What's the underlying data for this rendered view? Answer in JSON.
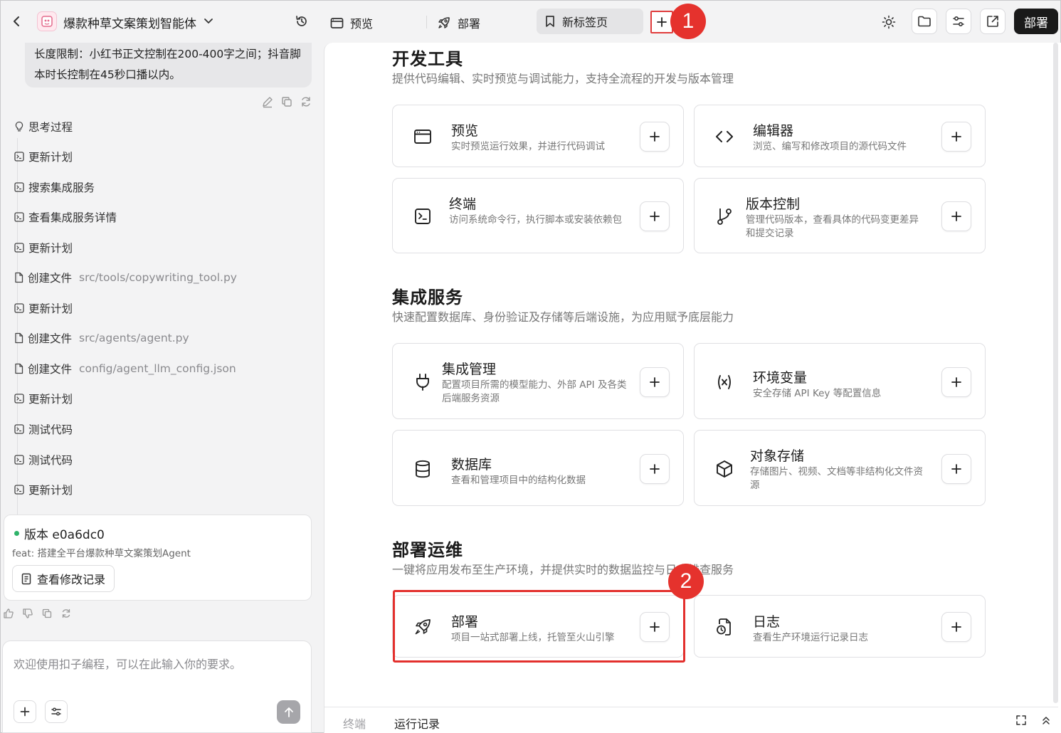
{
  "header": {
    "app_title": "爆款种草文案策划智能体",
    "tabs": [
      {
        "label": "预览",
        "icon": "browser-window-icon"
      },
      {
        "label": "部署",
        "icon": "rocket-icon"
      },
      {
        "label": "新标签页",
        "icon": "bookmark-icon",
        "active": true
      }
    ],
    "deploy_button": "部署"
  },
  "annotations": {
    "callout_1": "1",
    "callout_2": "2",
    "highlight_color": "#e3302d"
  },
  "chat": {
    "message": "长度限制：小红书正文控制在200-400字之间；抖音脚本时长控制在45秒口播以内。",
    "steps": [
      {
        "icon": "lightbulb-icon",
        "label": "思考过程",
        "path": ""
      },
      {
        "icon": "terminal-icon",
        "label": "更新计划",
        "path": ""
      },
      {
        "icon": "terminal-icon",
        "label": "搜索集成服务",
        "path": ""
      },
      {
        "icon": "terminal-icon",
        "label": "查看集成服务详情",
        "path": ""
      },
      {
        "icon": "terminal-icon",
        "label": "更新计划",
        "path": ""
      },
      {
        "icon": "file-icon",
        "label": "创建文件",
        "path": "src/tools/copywriting_tool.py"
      },
      {
        "icon": "terminal-icon",
        "label": "更新计划",
        "path": ""
      },
      {
        "icon": "file-icon",
        "label": "创建文件",
        "path": "src/agents/agent.py"
      },
      {
        "icon": "file-icon",
        "label": "创建文件",
        "path": "config/agent_llm_config.json"
      },
      {
        "icon": "terminal-icon",
        "label": "更新计划",
        "path": ""
      },
      {
        "icon": "terminal-icon",
        "label": "测试代码",
        "path": ""
      },
      {
        "icon": "terminal-icon",
        "label": "测试代码",
        "path": ""
      },
      {
        "icon": "terminal-icon",
        "label": "更新计划",
        "path": ""
      }
    ],
    "version": {
      "title": "版本 e0a6dc0",
      "commit": "feat: 搭建全平台爆款种草文案策划Agent",
      "button": "查看修改记录",
      "status_color": "#2fb36a"
    },
    "composer": {
      "placeholder": "欢迎使用扣子编程，可以在此输入你的要求。"
    }
  },
  "sections": [
    {
      "title": "开发工具",
      "desc": "提供代码编辑、实时预览与调试能力，支持全流程的开发与版本管理",
      "cards": [
        {
          "title": "预览",
          "desc": "实时预览运行效果，并进行代码调试",
          "icon": "browser-window-icon"
        },
        {
          "title": "编辑器",
          "desc": "浏览、编写和修改项目的源代码文件",
          "icon": "code-brackets-icon"
        },
        {
          "title": "终端",
          "desc": "访问系统命令行，执行脚本或安装依赖包",
          "icon": "terminal-icon"
        },
        {
          "title": "版本控制",
          "desc": "管理代码版本，查看具体的代码变更差异和提交记录",
          "icon": "git-branch-icon"
        }
      ]
    },
    {
      "title": "集成服务",
      "desc": "快速配置数据库、身份验证及存储等后端设施，为应用赋予底层能力",
      "cards": [
        {
          "title": "集成管理",
          "desc": "配置项目所需的模型能力、外部 API 及各类后端服务资源",
          "icon": "plug-icon"
        },
        {
          "title": "环境变量",
          "desc": "安全存储 API Key 等配置信息",
          "icon": "variable-icon"
        },
        {
          "title": "数据库",
          "desc": "查看和管理项目中的结构化数据",
          "icon": "database-icon"
        },
        {
          "title": "对象存储",
          "desc": "存储图片、视频、文档等非结构化文件资源",
          "icon": "cube-icon"
        }
      ]
    },
    {
      "title": "部署运维",
      "desc": "一键将应用发布至生产环境，并提供实时的数据监控与日志排查服务",
      "cards": [
        {
          "title": "部署",
          "desc": "项目一站式部署上线，托管至火山引擎",
          "icon": "rocket-icon"
        },
        {
          "title": "日志",
          "desc": "查看生产环境运行记录日志",
          "icon": "log-icon"
        }
      ]
    }
  ],
  "bottom": {
    "tabs": [
      {
        "label": "终端",
        "active": false
      },
      {
        "label": "运行记录",
        "active": true
      }
    ]
  }
}
